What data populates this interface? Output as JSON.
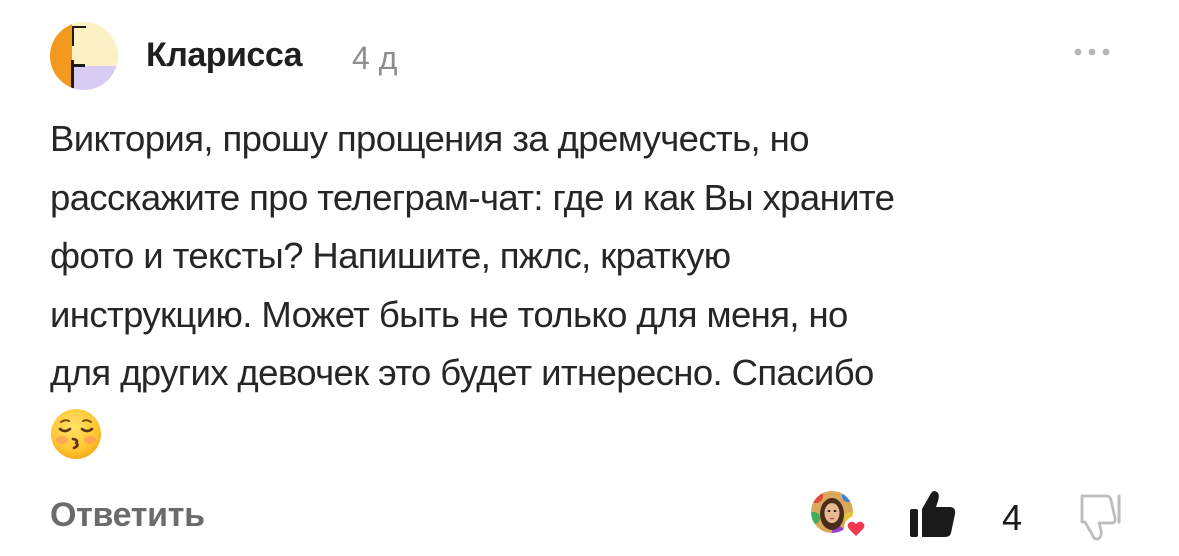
{
  "comment": {
    "author": "Кларисса",
    "age": "4 д",
    "lines": [
      "Виктория, прошу прощения за дремучесть, но",
      "расскажите про телеграм-чат: где и как Вы храните",
      "фото и тексты?  Напишите, пжлс, краткую",
      "инструкцию. Может быть не только для меня, но",
      "для других девочек это будет итнересно. Спасибо"
    ],
    "emoji": "kissing-face-with-closed-eyes"
  },
  "actions": {
    "reply_label": "Ответить",
    "like_count": "4"
  },
  "colors": {
    "avatar_orange": "#F39A1E",
    "avatar_cream": "#FBF1C4",
    "avatar_lilac": "#D9CCF4",
    "muted_text": "#8E8E8E",
    "heart": "#F0394E"
  }
}
